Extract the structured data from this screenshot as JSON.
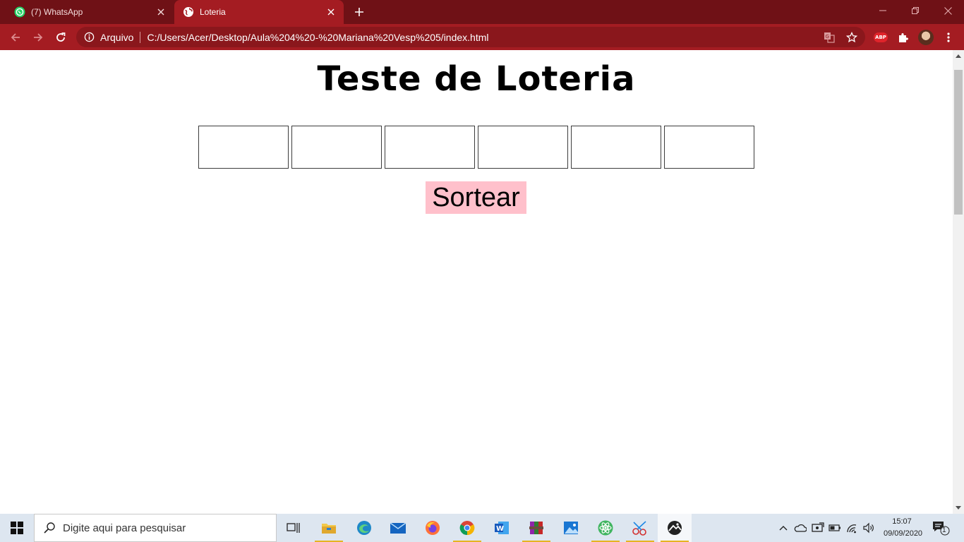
{
  "browser": {
    "tabs": [
      {
        "title": "(7) WhatsApp",
        "icon": "whatsapp-icon",
        "active": false
      },
      {
        "title": "Loteria",
        "icon": "globe-icon",
        "active": true
      }
    ],
    "omnibox": {
      "security_chip": "Arquivo",
      "url": "C:/Users/Acer/Desktop/Aula%204%20-%20Mariana%20Vesp%205/index.html"
    },
    "extensions": {
      "abp_label": "ABP"
    }
  },
  "page": {
    "title": "Teste de Loteria",
    "number_inputs": [
      "",
      "",
      "",
      "",
      "",
      ""
    ],
    "draw_button_label": "Sortear"
  },
  "taskbar": {
    "search_placeholder": "Digite aqui para pesquisar",
    "apps": [
      "task-view",
      "file-explorer",
      "edge",
      "mail",
      "firefox",
      "chrome",
      "word",
      "winrar",
      "photos",
      "atom",
      "snipping-tool",
      "browser"
    ],
    "clock_time": "15:07",
    "clock_date": "09/09/2020",
    "notification_count": "1"
  },
  "colors": {
    "tab_strip": "#6f1116",
    "toolbar": "#a41c22",
    "draw_button": "#ffc0cb",
    "taskbar": "#dde6f0"
  }
}
